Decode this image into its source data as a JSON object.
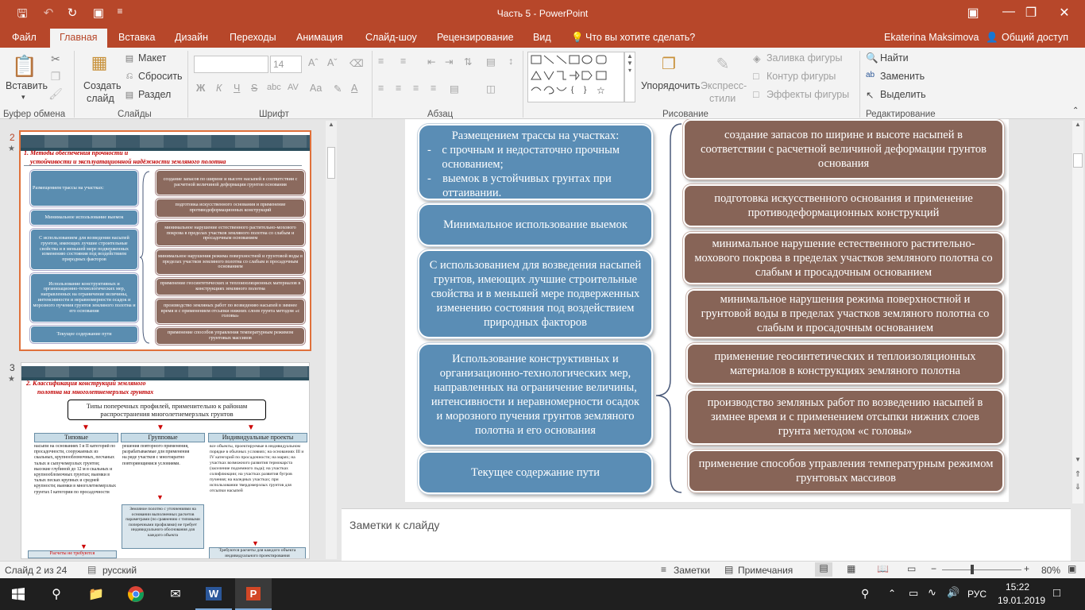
{
  "window": {
    "title": "Часть 5 - PowerPoint",
    "user": "Ekaterina Maksimova",
    "share": "Общий доступ",
    "tell_me": "Что вы хотите сделать?"
  },
  "menu": [
    "Файл",
    "Главная",
    "Вставка",
    "Дизайн",
    "Переходы",
    "Анимация",
    "Слайд-шоу",
    "Рецензирование",
    "Вид"
  ],
  "ribbon": {
    "paste": "Вставить",
    "new_slide": "Создать",
    "new_slide2": "слайд",
    "layout": "Макет",
    "reset": "Сбросить",
    "section": "Раздел",
    "font_size": "14",
    "bold": "Ж",
    "italic": "К",
    "underline": "Ч",
    "strike": "S",
    "shadow": "abc",
    "spacing": "AV",
    "case": "Aa",
    "arrange": "Упорядочить",
    "quick_styles": "Экспресс-",
    "quick_styles2": "стили",
    "fill": "Заливка фигуры",
    "outline": "Контур фигуры",
    "effects": "Эффекты фигуры",
    "find": "Найти",
    "replace": "Заменить",
    "select": "Выделить",
    "groups": {
      "clipboard": "Буфер обмена",
      "slides": "Слайды",
      "font": "Шрифт",
      "paragraph": "Абзац",
      "drawing": "Рисование",
      "editing": "Редактирование"
    }
  },
  "thumbnails": {
    "s2": {
      "num": "2",
      "title_l1": "1.   Методы обеспечения прочности и",
      "title_l2": "устойчивости и эксплуатационной надёжности  земляного полотна"
    },
    "s3": {
      "num": "3",
      "title_l1": "2.   Классификация конструкций земляного",
      "title_l2": "полотна на многолетнемерзлых грунтах",
      "box": "Типы поперечных профилей, применительно к районам распространения многолетнемерзлых грунтов",
      "c1": "Типовые",
      "c2": "Групповые",
      "c3": "Индивидуальные проекты",
      "c1_text": "насыпи на основаниях I и II категорий по просадочности, сооружаемых из скальных, крупнообломочных, песчаных талых и сыпучемерзлых грунтов; высокие глубиной до 12 м в скальных и крупнообломочных грунтах; выемки в талых песках крупных и средней крупности; выемки в многолетнемерзлых грунтах I категории по просадочности",
      "c2_text": "решения повторного применения, разрабатываемые для применения на ряде участков с многократно повторяющимися условиями.",
      "c3_text": "все объекты, проектируемые в индивидуальном порядке в обычных условиях; на основаниях III и IV категорий по просадочности; на марях; на участках возможного развития термокарста (заселение подземного льда); на участках солифлюкции; на участках развития бугров пучения; на наледных участках; при использовании твердомерзлых грунтов для отсыпки насыпей",
      "c1_foot": "Расчеты не требуются",
      "c2_foot": "Земляное полотно с уточнениями на основании выполненных расчетов параметрами (по сравнению с типовыми поперечными профилями) не требует индивидуального обоснования для каждого объекта",
      "c3_foot": "Требуются расчеты для каждого объекта индивидуального проектирования"
    }
  },
  "slide": {
    "left": [
      {
        "title": "Размещением трассы на участках:",
        "items": [
          "с прочным и недостаточно прочным основанием;",
          "выемок в  устойчивых грунтах при оттаивании."
        ]
      },
      {
        "text": "Минимальное использование выемок"
      },
      {
        "text": "С использованием для возведения насыпей грунтов, имеющих лучшие строительные свойства и в меньшей мере подверженных изменению состояния под воздействием природных факторов"
      },
      {
        "text": "Использование конструктивных и организационно-технологических мер, направленных на ограничение величины, интенсивности и неравномерности осадок и морозного пучения грунтов земляного полотна и его основания"
      },
      {
        "text": "Текущее содержание пути"
      }
    ],
    "right": [
      "создание запасов по ширине и высоте насыпей в соответствии с расчетной величиной деформации грунтов основания",
      "подготовка искусственного основания и применение противодеформационных конструкций",
      "минимальное  нарушение естественного растительно-мохового покрова в пределах участков земляного полотна со слабым и просадочным основанием",
      "минимальное  нарушения режима поверхностной и грунтовой воды в пределах участков земляного полотна со слабым и просадочным основанием",
      "применение геосинтетических и теплоизоляционных материалов в конструкциях земляного полотна",
      "производство земляных работ по возведению насыпей в зимнее время и с применением отсыпки нижних слоев грунта методом «с головы»",
      "применение способов управления температурным режимом грунтовых массивов"
    ]
  },
  "notes_placeholder": "Заметки к слайду",
  "status": {
    "slide_of": "Слайд 2 из 24",
    "language": "русский",
    "notes": "Заметки",
    "comments": "Примечания",
    "zoom": "80%"
  },
  "taskbar": {
    "lang": "РУС",
    "time": "15:22",
    "date": "19.01.2019"
  },
  "colors": {
    "accent": "#b7472a",
    "left_box": "#5a8db5",
    "right_box": "#876457"
  }
}
